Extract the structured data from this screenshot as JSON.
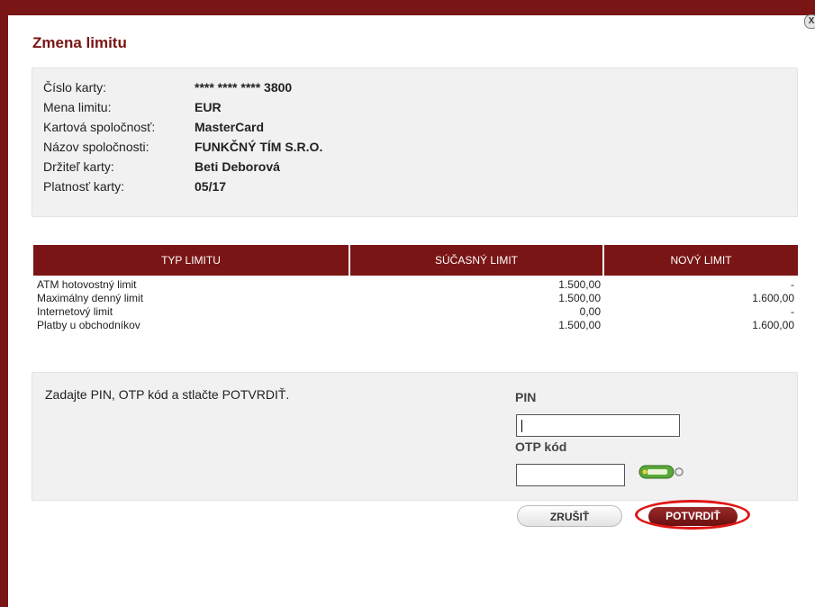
{
  "dialog": {
    "title": "Zmena limitu",
    "close_label": "X"
  },
  "card_info": [
    {
      "label": "Číslo karty:",
      "value": "**** **** **** 3800"
    },
    {
      "label": "Mena limitu:",
      "value": "EUR"
    },
    {
      "label": "Kartová spoločnosť:",
      "value": "MasterCard"
    },
    {
      "label": "Názov spoločnosti:",
      "value": "FUNKČNÝ TÍM S.R.O."
    },
    {
      "label": "Držiteľ karty:",
      "value": "Beti Deborová"
    },
    {
      "label": "Platnosť karty:",
      "value": "05/17"
    }
  ],
  "limits_table": {
    "headers": [
      "TYP LIMITU",
      "SÚČASNÝ LIMIT",
      "NOVÝ LIMIT"
    ],
    "rows": [
      {
        "type": "ATM hotovostný limit",
        "current": "1.500,00",
        "new": "-"
      },
      {
        "type": "Maximálny denný limit",
        "current": "1.500,00",
        "new": "1.600,00"
      },
      {
        "type": "Internetový limit",
        "current": "0,00",
        "new": "-"
      },
      {
        "type": "Platby u obchodníkov",
        "current": "1.500,00",
        "new": "1.600,00"
      }
    ]
  },
  "auth": {
    "instruction": "Zadajte PIN, OTP kód a stlačte POTVRDIŤ.",
    "pin_label": "PIN",
    "pin_value": "",
    "otp_label": "OTP kód",
    "otp_value": ""
  },
  "buttons": {
    "cancel": "ZRUŠIŤ",
    "confirm": "POTVRDIŤ"
  },
  "colors": {
    "brand": "#7a1515",
    "highlight": "#e01515",
    "panel": "#f1f1f1"
  },
  "icons": {
    "token": "otp-token-icon",
    "close": "close-icon"
  }
}
